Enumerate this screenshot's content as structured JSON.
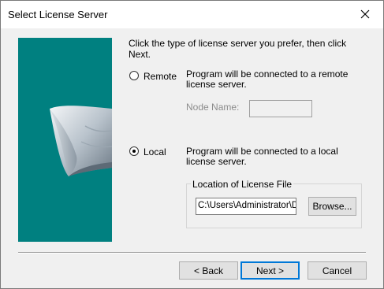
{
  "window": {
    "title": "Select License Server",
    "close_glyph": "✕"
  },
  "intro_text": "Click the type of license server you prefer, then click Next.",
  "options": {
    "remote": {
      "label": "Remote",
      "description": "Program will be connected to a remote license server.",
      "selected": false,
      "node_label": "Node Name:",
      "node_value": ""
    },
    "local": {
      "label": "Local",
      "description": "Program will be connected to a local license server.",
      "selected": true
    }
  },
  "license_file": {
    "group_title": "Location of License File",
    "path": "C:\\Users\\Administrator\\De",
    "browse_label": "Browse..."
  },
  "buttons": {
    "back": "< Back",
    "next": "Next >",
    "cancel": "Cancel"
  },
  "colors": {
    "side_panel": "#008080",
    "accent": "#0078d7"
  }
}
